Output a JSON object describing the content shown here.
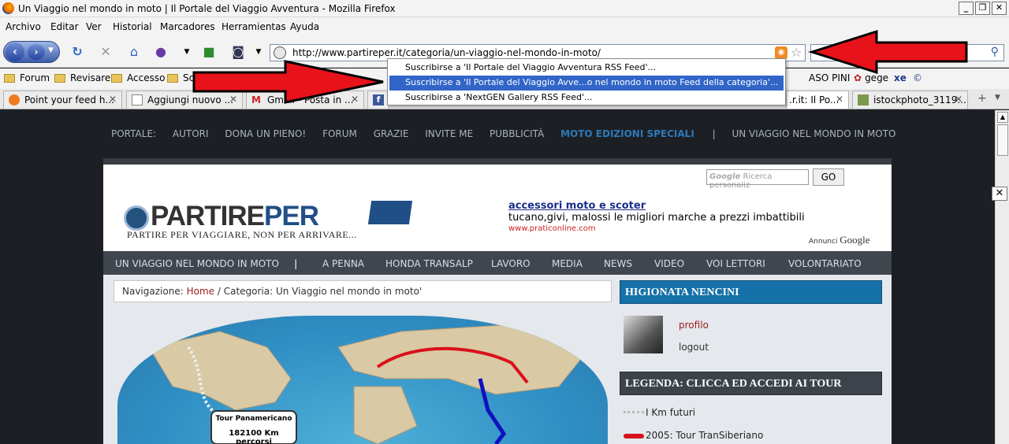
{
  "window": {
    "title": "Un Viaggio nel mondo in moto | Il Portale del Viaggio Avventura - Mozilla Firefox",
    "min_label": "_",
    "max_label": "❐",
    "close_label": "✕"
  },
  "menu": [
    "Archivo",
    "Editar",
    "Ver",
    "Historial",
    "Marcadores",
    "Herramientas",
    "Ayuda"
  ],
  "url": "http://www.partireper.it/categoria/un-viaggio-nel-mondo-in-moto/",
  "bookmarks": [
    "Forum",
    "Revisare",
    "Accesso",
    "Sc",
    "ASO PINI",
    "gege"
  ],
  "tabs": [
    {
      "label": "Point your feed h..."
    },
    {
      "label": "Aggiungi nuovo ..."
    },
    {
      "label": "Gmail - Posta in ..."
    },
    {
      "label": ".r.it: Il Po..."
    },
    {
      "label": "istockphoto_3119..."
    }
  ],
  "feed_menu": [
    "Suscribirse a 'Il Portale del Viaggio Avventura RSS Feed'...",
    "Suscribirse a 'Il Portale del Viaggio Avve...o nel mondo in moto Feed della categoria'...",
    "Suscribirse a 'NextGEN Gallery RSS Feed'..."
  ],
  "topnav": {
    "items": [
      "PORTALE:",
      "AUTORI",
      "DONA UN PIENO!",
      "FORUM",
      "GRAZIE",
      "INVITE ME",
      "PUBBLICITÀ"
    ],
    "highlight": "MOTO EDIZIONI SPECIALI",
    "sep": "|",
    "last": "UN VIAGGIO NEL MONDO IN MOTO"
  },
  "search": {
    "placeholder": "Ricerca personaliz",
    "go": "GO",
    "brand": "Google"
  },
  "logo": {
    "part": "PARTIRE",
    "per": "PER",
    "tagline": "PARTIRE PER VIAGGIARE, NON PER ARRIVARE..."
  },
  "ad": {
    "title": "accessori moto e scoter",
    "desc": "tucano,givi, malossi le migliori marche a prezzi imbattibili",
    "url": "www.praticonline.com",
    "annunci": "Annunci",
    "google": "Google"
  },
  "mainnav": [
    "UN VIAGGIO NEL MONDO IN MOTO",
    "|",
    "A PENNA",
    "HONDA TRANSALP",
    "LAVORO",
    "MEDIA",
    "NEWS",
    "VIDEO",
    "VOI LETTORI",
    "VOLONTARIATO"
  ],
  "breadcrumb": {
    "prefix": "Navigazione:",
    "home": "Home",
    "sep": "/",
    "current": "Categoria: Un Viaggio nel mondo in moto'"
  },
  "tourbox": {
    "title": "Tour Panamericano",
    "km": "182100 Km percorsi"
  },
  "sidebar": {
    "user_head": "HIGIONATA NENCINI",
    "profilo": "profilo",
    "logout": "logout",
    "legend_head": "LEGENDA: CLICCA ED ACCEDI AI TOUR",
    "legend": [
      {
        "label": "I Km futuri",
        "color": "#cccccc"
      },
      {
        "label": "2005: Tour TranSiberiano",
        "color": "#d9101a"
      }
    ]
  },
  "colors": {
    "accent": "#1671a8",
    "nav_bg": "#40464e",
    "page_bg": "#1c1f24",
    "highlight": "#2e79b8",
    "select": "#3166c8"
  }
}
